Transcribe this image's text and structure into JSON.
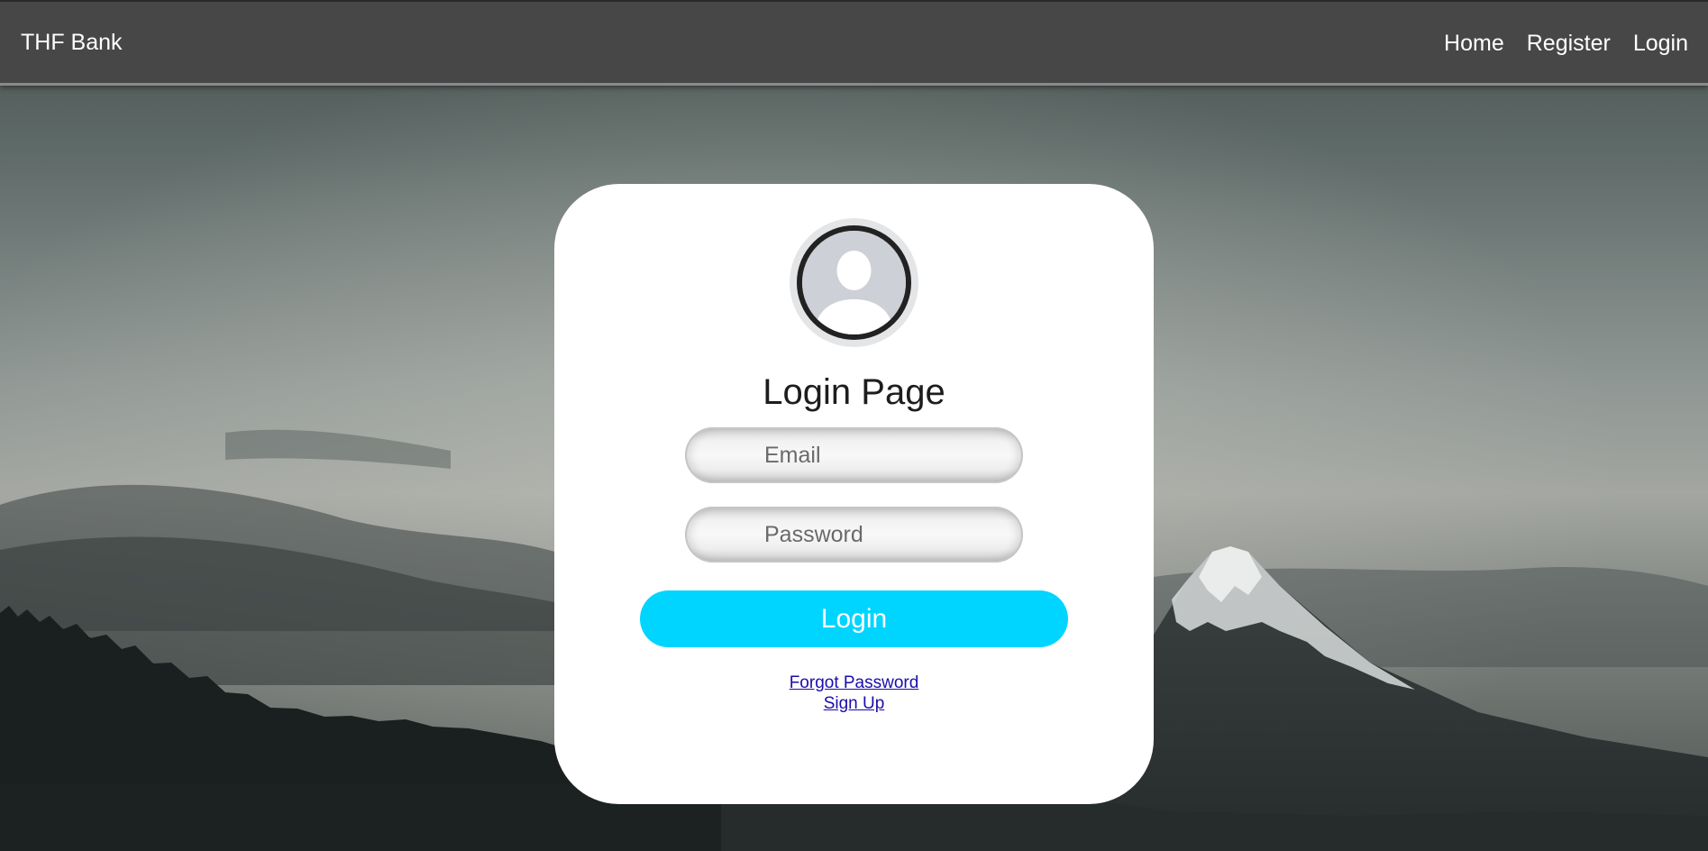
{
  "navbar": {
    "brand": "THF Bank",
    "links": [
      "Home",
      "Register",
      "Login"
    ]
  },
  "login_card": {
    "title": "Login Page",
    "email_placeholder": "Email",
    "password_placeholder": "Password",
    "login_button": "Login",
    "forgot_password": "Forgot Password",
    "sign_up": "Sign Up"
  },
  "colors": {
    "navbar_bg": "#474747",
    "button_bg": "#00d5ff",
    "link": "#1a0dab",
    "card_bg": "#ffffff"
  },
  "icons": {
    "avatar": "user-avatar-icon"
  }
}
